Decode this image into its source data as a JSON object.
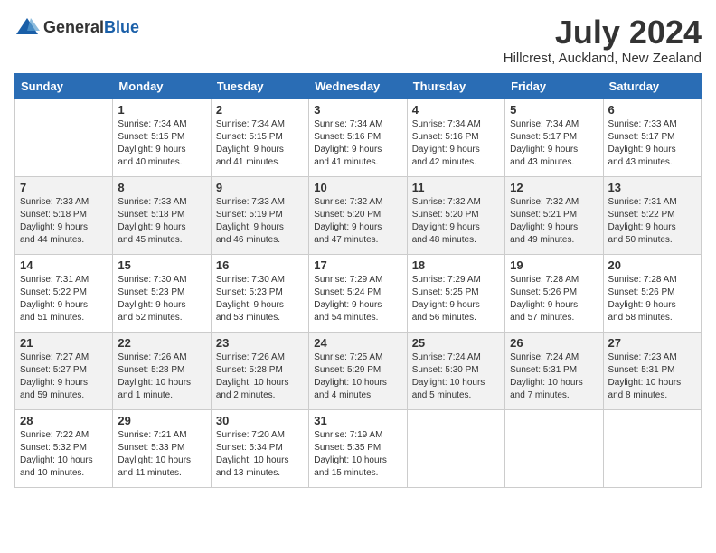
{
  "header": {
    "logo_general": "General",
    "logo_blue": "Blue",
    "month_year": "July 2024",
    "location": "Hillcrest, Auckland, New Zealand"
  },
  "days_of_week": [
    "Sunday",
    "Monday",
    "Tuesday",
    "Wednesday",
    "Thursday",
    "Friday",
    "Saturday"
  ],
  "weeks": [
    [
      {
        "day": "",
        "info": ""
      },
      {
        "day": "1",
        "info": "Sunrise: 7:34 AM\nSunset: 5:15 PM\nDaylight: 9 hours\nand 40 minutes."
      },
      {
        "day": "2",
        "info": "Sunrise: 7:34 AM\nSunset: 5:15 PM\nDaylight: 9 hours\nand 41 minutes."
      },
      {
        "day": "3",
        "info": "Sunrise: 7:34 AM\nSunset: 5:16 PM\nDaylight: 9 hours\nand 41 minutes."
      },
      {
        "day": "4",
        "info": "Sunrise: 7:34 AM\nSunset: 5:16 PM\nDaylight: 9 hours\nand 42 minutes."
      },
      {
        "day": "5",
        "info": "Sunrise: 7:34 AM\nSunset: 5:17 PM\nDaylight: 9 hours\nand 43 minutes."
      },
      {
        "day": "6",
        "info": "Sunrise: 7:33 AM\nSunset: 5:17 PM\nDaylight: 9 hours\nand 43 minutes."
      }
    ],
    [
      {
        "day": "7",
        "info": "Sunrise: 7:33 AM\nSunset: 5:18 PM\nDaylight: 9 hours\nand 44 minutes."
      },
      {
        "day": "8",
        "info": "Sunrise: 7:33 AM\nSunset: 5:18 PM\nDaylight: 9 hours\nand 45 minutes."
      },
      {
        "day": "9",
        "info": "Sunrise: 7:33 AM\nSunset: 5:19 PM\nDaylight: 9 hours\nand 46 minutes."
      },
      {
        "day": "10",
        "info": "Sunrise: 7:32 AM\nSunset: 5:20 PM\nDaylight: 9 hours\nand 47 minutes."
      },
      {
        "day": "11",
        "info": "Sunrise: 7:32 AM\nSunset: 5:20 PM\nDaylight: 9 hours\nand 48 minutes."
      },
      {
        "day": "12",
        "info": "Sunrise: 7:32 AM\nSunset: 5:21 PM\nDaylight: 9 hours\nand 49 minutes."
      },
      {
        "day": "13",
        "info": "Sunrise: 7:31 AM\nSunset: 5:22 PM\nDaylight: 9 hours\nand 50 minutes."
      }
    ],
    [
      {
        "day": "14",
        "info": "Sunrise: 7:31 AM\nSunset: 5:22 PM\nDaylight: 9 hours\nand 51 minutes."
      },
      {
        "day": "15",
        "info": "Sunrise: 7:30 AM\nSunset: 5:23 PM\nDaylight: 9 hours\nand 52 minutes."
      },
      {
        "day": "16",
        "info": "Sunrise: 7:30 AM\nSunset: 5:23 PM\nDaylight: 9 hours\nand 53 minutes."
      },
      {
        "day": "17",
        "info": "Sunrise: 7:29 AM\nSunset: 5:24 PM\nDaylight: 9 hours\nand 54 minutes."
      },
      {
        "day": "18",
        "info": "Sunrise: 7:29 AM\nSunset: 5:25 PM\nDaylight: 9 hours\nand 56 minutes."
      },
      {
        "day": "19",
        "info": "Sunrise: 7:28 AM\nSunset: 5:26 PM\nDaylight: 9 hours\nand 57 minutes."
      },
      {
        "day": "20",
        "info": "Sunrise: 7:28 AM\nSunset: 5:26 PM\nDaylight: 9 hours\nand 58 minutes."
      }
    ],
    [
      {
        "day": "21",
        "info": "Sunrise: 7:27 AM\nSunset: 5:27 PM\nDaylight: 9 hours\nand 59 minutes."
      },
      {
        "day": "22",
        "info": "Sunrise: 7:26 AM\nSunset: 5:28 PM\nDaylight: 10 hours\nand 1 minute."
      },
      {
        "day": "23",
        "info": "Sunrise: 7:26 AM\nSunset: 5:28 PM\nDaylight: 10 hours\nand 2 minutes."
      },
      {
        "day": "24",
        "info": "Sunrise: 7:25 AM\nSunset: 5:29 PM\nDaylight: 10 hours\nand 4 minutes."
      },
      {
        "day": "25",
        "info": "Sunrise: 7:24 AM\nSunset: 5:30 PM\nDaylight: 10 hours\nand 5 minutes."
      },
      {
        "day": "26",
        "info": "Sunrise: 7:24 AM\nSunset: 5:31 PM\nDaylight: 10 hours\nand 7 minutes."
      },
      {
        "day": "27",
        "info": "Sunrise: 7:23 AM\nSunset: 5:31 PM\nDaylight: 10 hours\nand 8 minutes."
      }
    ],
    [
      {
        "day": "28",
        "info": "Sunrise: 7:22 AM\nSunset: 5:32 PM\nDaylight: 10 hours\nand 10 minutes."
      },
      {
        "day": "29",
        "info": "Sunrise: 7:21 AM\nSunset: 5:33 PM\nDaylight: 10 hours\nand 11 minutes."
      },
      {
        "day": "30",
        "info": "Sunrise: 7:20 AM\nSunset: 5:34 PM\nDaylight: 10 hours\nand 13 minutes."
      },
      {
        "day": "31",
        "info": "Sunrise: 7:19 AM\nSunset: 5:35 PM\nDaylight: 10 hours\nand 15 minutes."
      },
      {
        "day": "",
        "info": ""
      },
      {
        "day": "",
        "info": ""
      },
      {
        "day": "",
        "info": ""
      }
    ]
  ]
}
